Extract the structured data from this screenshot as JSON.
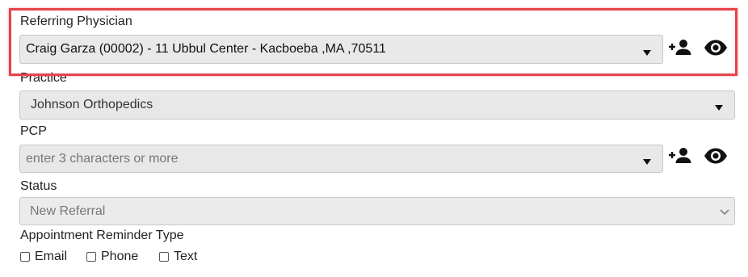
{
  "referring_physician": {
    "label": "Referring Physician",
    "value": "Craig Garza (00002) - 11 Ubbul Center - Kacboeba ,MA ,70511",
    "add_icon": "add-person-icon",
    "view_icon": "eye-icon"
  },
  "practice": {
    "label": "Practice",
    "value": "Johnson Orthopedics"
  },
  "pcp": {
    "label": "PCP",
    "placeholder": "enter 3 characters or more",
    "add_icon": "add-person-icon",
    "view_icon": "eye-icon"
  },
  "status": {
    "label": "Status",
    "value": "New Referral"
  },
  "appointment_reminder": {
    "label": "Appointment Reminder Type",
    "options": [
      {
        "label": "Email",
        "checked": false
      },
      {
        "label": "Phone",
        "checked": false
      },
      {
        "label": "Text",
        "checked": false
      }
    ]
  },
  "colors": {
    "highlight": "#e8434a",
    "field_bg": "#e8e8e8",
    "muted_text": "#777777"
  }
}
